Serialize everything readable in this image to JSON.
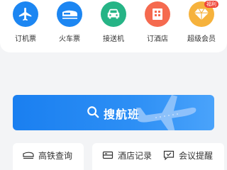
{
  "colors": {
    "primary_blue": "#1a7ff0",
    "green": "#26b486",
    "orange_red": "#f56a4f",
    "gold": "#f6b23c",
    "background": "#f3f4f6"
  },
  "services": [
    {
      "label": "订机票",
      "icon": "airplane-icon",
      "color": "#1c86f2"
    },
    {
      "label": "火车票",
      "icon": "train-icon",
      "color": "#1c86f2"
    },
    {
      "label": "接送机",
      "icon": "car-icon",
      "color": "#26b486"
    },
    {
      "label": "订酒店",
      "icon": "hotel-icon",
      "color": "#f56a4f"
    },
    {
      "label": "超级会员",
      "icon": "diamond-icon",
      "color": "#f6b23c",
      "badge": "福利"
    }
  ],
  "search": {
    "label": "搜航班",
    "icon": "search-icon"
  },
  "quick_links": [
    {
      "label": "高铁查询",
      "icon": "train-outline-icon"
    },
    {
      "label": "酒店记录",
      "icon": "bed-icon"
    },
    {
      "label": "会议提醒",
      "icon": "chat-check-icon"
    }
  ]
}
